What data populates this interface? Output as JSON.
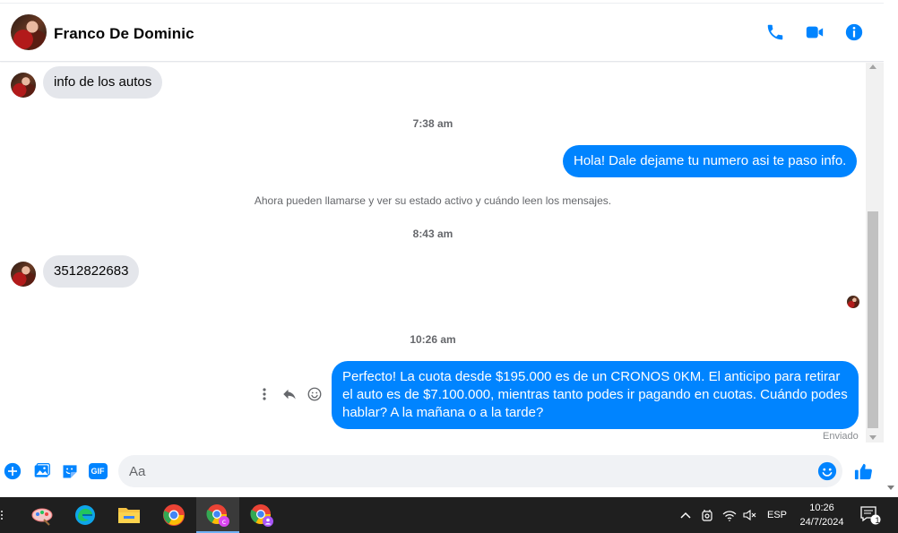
{
  "header": {
    "contact_name": "Franco De Dominic",
    "icons": [
      "phone-icon",
      "video-camera-icon",
      "info-icon"
    ]
  },
  "colors": {
    "accent": "#0084ff",
    "incoming_bubble": "#e4e6eb",
    "taskbar": "#1f1f1f"
  },
  "messages": [
    {
      "type": "incoming",
      "text": "info de los autos"
    },
    {
      "type": "timestamp",
      "text": "7:38 am"
    },
    {
      "type": "outgoing",
      "text": "Hola! Dale dejame tu numero  asi te paso info."
    },
    {
      "type": "system",
      "text": "Ahora pueden llamarse y ver su estado activo y cuándo leen los mensajes."
    },
    {
      "type": "timestamp",
      "text": "8:43 am"
    },
    {
      "type": "incoming",
      "text": "3512822683"
    },
    {
      "type": "timestamp",
      "text": "10:26 am"
    },
    {
      "type": "outgoing",
      "text": "Perfecto! La cuota desde $195.000 es de un CRONOS 0KM. El anticipo para retirar el auto es de $7.100.000, mientras tanto podes ir pagando en cuotas. Cuándo podes hablar? A la mañana o a la tarde?"
    }
  ],
  "status": {
    "sent_label": "Enviado"
  },
  "composer": {
    "placeholder": "Aa",
    "icons": [
      "plus-icon",
      "image-icon",
      "sticker-icon",
      "gif-icon",
      "emoji-icon",
      "thumbs-up-icon"
    ],
    "gif_label": "GIF"
  },
  "taskbar": {
    "apps": [
      "paint-icon",
      "edge-icon",
      "file-explorer-icon",
      "chrome-icon",
      "chrome-profile-c-icon",
      "chrome-profile-2-icon"
    ],
    "tray": {
      "language": "ESP",
      "time": "10:26",
      "date": "24/7/2024",
      "notification_count": "1"
    }
  }
}
